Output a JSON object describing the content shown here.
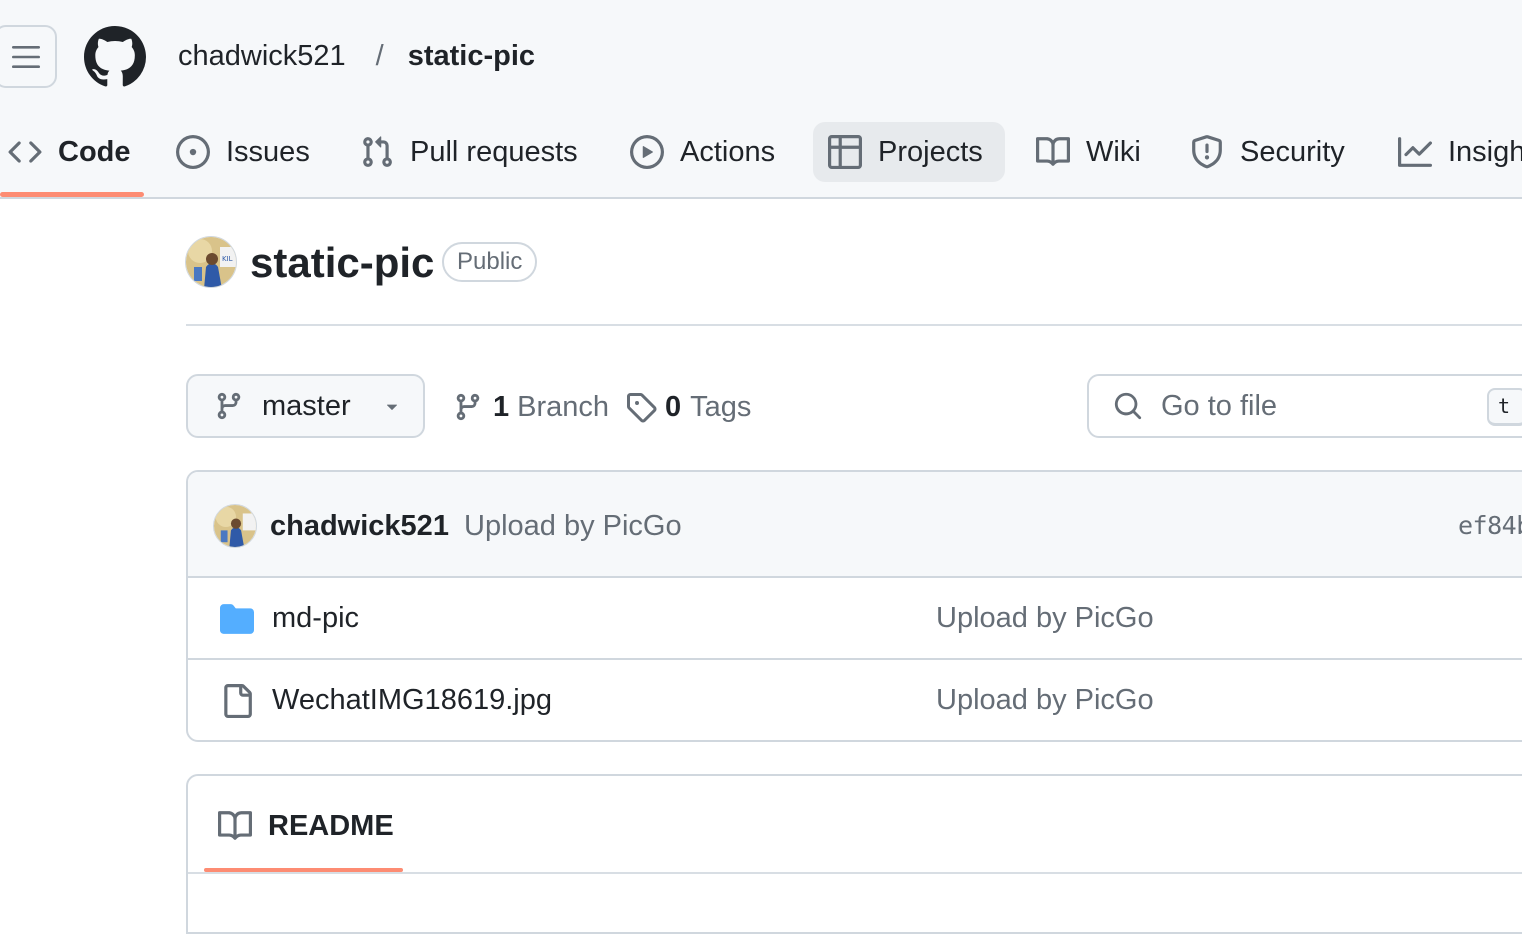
{
  "header": {
    "owner": "chadwick521",
    "separator": "/",
    "repo": "static-pic"
  },
  "tabs": [
    {
      "label": "Code",
      "icon": "code-icon",
      "selected": true
    },
    {
      "label": "Issues",
      "icon": "issue-opened-icon"
    },
    {
      "label": "Pull requests",
      "icon": "git-pull-request-icon"
    },
    {
      "label": "Actions",
      "icon": "play-icon"
    },
    {
      "label": "Projects",
      "icon": "table-icon"
    },
    {
      "label": "Wiki",
      "icon": "book-icon"
    },
    {
      "label": "Security",
      "icon": "shield-icon"
    },
    {
      "label": "Insigh",
      "icon": "graph-icon"
    }
  ],
  "repo": {
    "title": "static-pic",
    "visibility": "Public"
  },
  "branch_bar": {
    "current_branch": "master",
    "branch_count": "1",
    "branch_label": "Branch",
    "tag_count": "0",
    "tag_label": "Tags",
    "goto_placeholder": "Go to file",
    "goto_shortcut": "t"
  },
  "latest_commit": {
    "author": "chadwick521",
    "message": "Upload by PicGo",
    "sha": "ef84b"
  },
  "files": [
    {
      "name": "md-pic",
      "type": "folder",
      "icon": "folder-icon",
      "commit_message": "Upload by PicGo"
    },
    {
      "name": "WechatIMG18619.jpg",
      "type": "file",
      "icon": "file-icon",
      "commit_message": "Upload by PicGo"
    }
  ],
  "readme": {
    "tab_label": "README"
  },
  "colors": {
    "accent_underline": "#fd8c73",
    "folder": "#54aeff",
    "border": "#d0d7de",
    "muted_text": "#656d76"
  }
}
